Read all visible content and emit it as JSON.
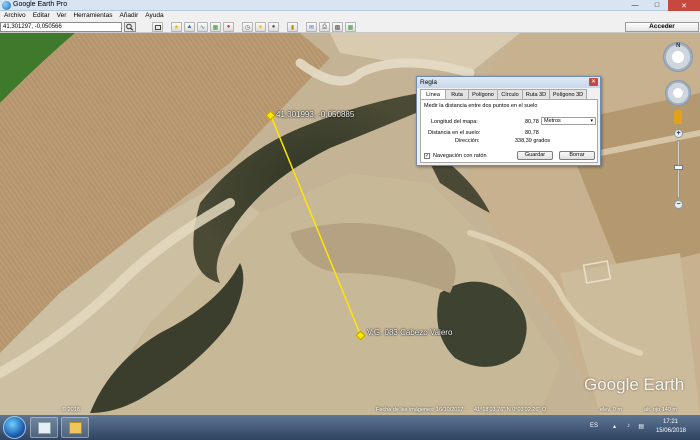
{
  "window": {
    "title": "Google Earth Pro"
  },
  "menu": [
    "Archivo",
    "Editar",
    "Ver",
    "Herramientas",
    "Añadir",
    "Ayuda"
  ],
  "search": {
    "value": "41,301297, -0,050566"
  },
  "toolbar": {
    "signin_label": "Acceder"
  },
  "map": {
    "placemarks": [
      {
        "label": "41,301993, -0,050885"
      },
      {
        "label": "V.G. 083 Cabezo Valero"
      }
    ],
    "ruler_line_color": "#ffe600",
    "logo": "Google Earth"
  },
  "status_bar": {
    "left": "© 2018",
    "date": "Fecha de las imágenes: 16/10/2017",
    "coords": "41°18'03.76\" N   0°03'02.26\" O",
    "elev": "elev.  0 m",
    "eye": "alt. ojo  140 m"
  },
  "dialog": {
    "title": "Regla",
    "tabs": [
      "Línea",
      "Ruta",
      "Polígono",
      "Círculo",
      "Ruta 3D",
      "Polígono 3D"
    ],
    "active_tab": "Línea",
    "description": "Medir la distancia entre dos puntos en el suelo",
    "map_length_label": "Longitud del mapa:",
    "map_length_value": "80,78",
    "unit": "Metros",
    "ground_length_label": "Distancia en el suelo:",
    "ground_length_value": "80,78",
    "heading_label": "Dirección:",
    "heading_value": "338,39 grados",
    "nav_checkbox_label": "Navegación con ratón",
    "nav_checked": true,
    "save_label": "Guardar",
    "clear_label": "Borrar"
  },
  "taskbar": {
    "lang": "ES",
    "time": "17:21",
    "date": "15/06/2018"
  }
}
